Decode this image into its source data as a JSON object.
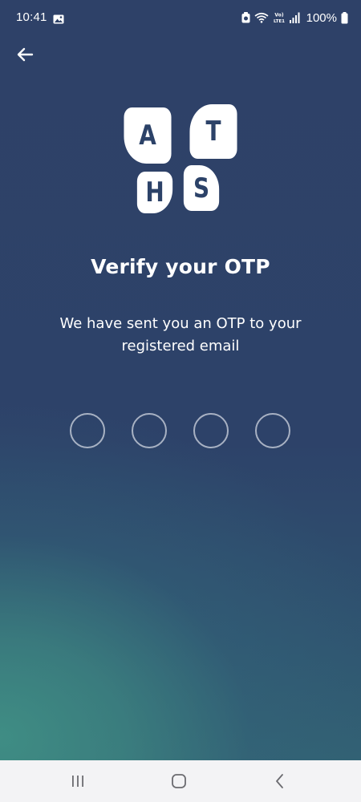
{
  "status_bar": {
    "time": "10:41",
    "battery_text": "100%",
    "network_label": "LTE1"
  },
  "header": {
    "back_icon": "arrow-left-icon"
  },
  "logo": {
    "letters": [
      "A",
      "T",
      "H",
      "S"
    ]
  },
  "content": {
    "title": "Verify your OTP",
    "subtitle": "We have sent you an OTP to your registered email"
  },
  "otp": {
    "length": 4,
    "values": [
      "",
      "",
      "",
      ""
    ]
  },
  "nav_bar": {
    "icons": [
      "recents-icon",
      "home-icon",
      "back-icon"
    ]
  },
  "colors": {
    "background_top": "#2e4168",
    "background_bottom_left": "#3f8d84",
    "logo_tile": "#ffffff",
    "logo_letter": "#2c4268",
    "otp_border": "#d2d7e1",
    "nav_bar": "#f3f3f5"
  }
}
